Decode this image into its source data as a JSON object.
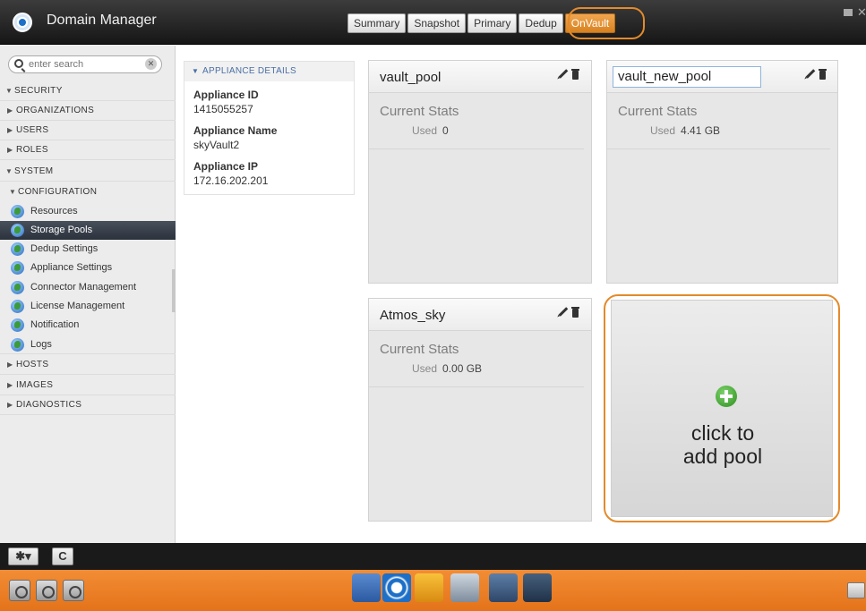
{
  "app": {
    "title": "Domain Manager"
  },
  "tabs": [
    {
      "label": "Summary"
    },
    {
      "label": "Snapshot"
    },
    {
      "label": "Primary"
    },
    {
      "label": "Dedup"
    },
    {
      "label": "OnVault",
      "active": true
    }
  ],
  "search": {
    "placeholder": "enter search",
    "value": ""
  },
  "nav": {
    "security": "SECURITY",
    "organizations": "ORGANIZATIONS",
    "users": "USERS",
    "roles": "ROLES",
    "system": "SYSTEM",
    "configuration": "CONFIGURATION",
    "config_items": [
      {
        "label": "Resources"
      },
      {
        "label": "Storage Pools",
        "selected": true
      },
      {
        "label": "Dedup Settings"
      },
      {
        "label": "Appliance Settings"
      },
      {
        "label": "Connector Management"
      },
      {
        "label": "License Management"
      },
      {
        "label": "Notification"
      },
      {
        "label": "Logs"
      }
    ],
    "hosts": "HOSTS",
    "images": "IMAGES",
    "diagnostics": "DIAGNOSTICS"
  },
  "appliance": {
    "header": "APPLIANCE DETAILS",
    "id_label": "Appliance ID",
    "id_value": "1415055257",
    "name_label": "Appliance Name",
    "name_value": "skyVault2",
    "ip_label": "Appliance IP",
    "ip_value": "172.16.202.201"
  },
  "pools": [
    {
      "name": "vault_pool",
      "stats_title": "Current Stats",
      "used_label": "Used",
      "used_value": "0"
    },
    {
      "name": "vault_new_pool",
      "stats_title": "Current Stats",
      "used_label": "Used",
      "used_value": "4.41 GB",
      "editing": true
    },
    {
      "name": "Atmos_sky",
      "stats_title": "Current Stats",
      "used_label": "Used",
      "used_value": "0.00 GB"
    }
  ],
  "add_pool": {
    "line1": "click to",
    "line2": "add pool"
  },
  "toolbar": {
    "gear_label": "✱▾",
    "refresh_label": "C"
  },
  "colors": {
    "accent": "#e38a2b",
    "taskbar": "#ee8229",
    "selected": "#2f3640"
  }
}
